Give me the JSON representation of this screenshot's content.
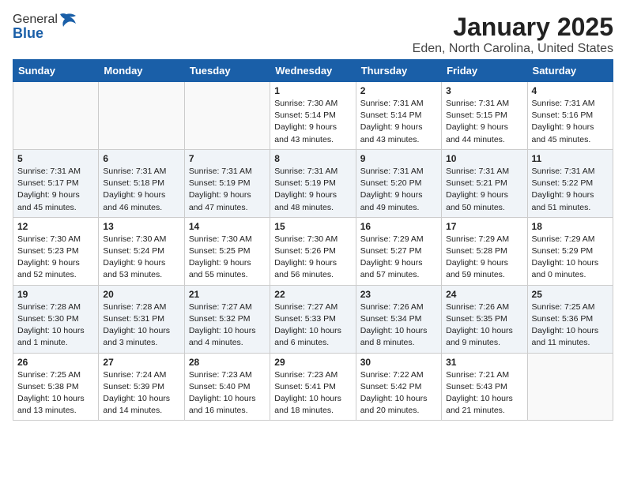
{
  "logo": {
    "general": "General",
    "blue": "Blue"
  },
  "title": "January 2025",
  "subtitle": "Eden, North Carolina, United States",
  "weekdays": [
    "Sunday",
    "Monday",
    "Tuesday",
    "Wednesday",
    "Thursday",
    "Friday",
    "Saturday"
  ],
  "weeks": [
    [
      {
        "day": "",
        "info": ""
      },
      {
        "day": "",
        "info": ""
      },
      {
        "day": "",
        "info": ""
      },
      {
        "day": "1",
        "info": "Sunrise: 7:30 AM\nSunset: 5:14 PM\nDaylight: 9 hours\nand 43 minutes."
      },
      {
        "day": "2",
        "info": "Sunrise: 7:31 AM\nSunset: 5:14 PM\nDaylight: 9 hours\nand 43 minutes."
      },
      {
        "day": "3",
        "info": "Sunrise: 7:31 AM\nSunset: 5:15 PM\nDaylight: 9 hours\nand 44 minutes."
      },
      {
        "day": "4",
        "info": "Sunrise: 7:31 AM\nSunset: 5:16 PM\nDaylight: 9 hours\nand 45 minutes."
      }
    ],
    [
      {
        "day": "5",
        "info": "Sunrise: 7:31 AM\nSunset: 5:17 PM\nDaylight: 9 hours\nand 45 minutes."
      },
      {
        "day": "6",
        "info": "Sunrise: 7:31 AM\nSunset: 5:18 PM\nDaylight: 9 hours\nand 46 minutes."
      },
      {
        "day": "7",
        "info": "Sunrise: 7:31 AM\nSunset: 5:19 PM\nDaylight: 9 hours\nand 47 minutes."
      },
      {
        "day": "8",
        "info": "Sunrise: 7:31 AM\nSunset: 5:19 PM\nDaylight: 9 hours\nand 48 minutes."
      },
      {
        "day": "9",
        "info": "Sunrise: 7:31 AM\nSunset: 5:20 PM\nDaylight: 9 hours\nand 49 minutes."
      },
      {
        "day": "10",
        "info": "Sunrise: 7:31 AM\nSunset: 5:21 PM\nDaylight: 9 hours\nand 50 minutes."
      },
      {
        "day": "11",
        "info": "Sunrise: 7:31 AM\nSunset: 5:22 PM\nDaylight: 9 hours\nand 51 minutes."
      }
    ],
    [
      {
        "day": "12",
        "info": "Sunrise: 7:30 AM\nSunset: 5:23 PM\nDaylight: 9 hours\nand 52 minutes."
      },
      {
        "day": "13",
        "info": "Sunrise: 7:30 AM\nSunset: 5:24 PM\nDaylight: 9 hours\nand 53 minutes."
      },
      {
        "day": "14",
        "info": "Sunrise: 7:30 AM\nSunset: 5:25 PM\nDaylight: 9 hours\nand 55 minutes."
      },
      {
        "day": "15",
        "info": "Sunrise: 7:30 AM\nSunset: 5:26 PM\nDaylight: 9 hours\nand 56 minutes."
      },
      {
        "day": "16",
        "info": "Sunrise: 7:29 AM\nSunset: 5:27 PM\nDaylight: 9 hours\nand 57 minutes."
      },
      {
        "day": "17",
        "info": "Sunrise: 7:29 AM\nSunset: 5:28 PM\nDaylight: 9 hours\nand 59 minutes."
      },
      {
        "day": "18",
        "info": "Sunrise: 7:29 AM\nSunset: 5:29 PM\nDaylight: 10 hours\nand 0 minutes."
      }
    ],
    [
      {
        "day": "19",
        "info": "Sunrise: 7:28 AM\nSunset: 5:30 PM\nDaylight: 10 hours\nand 1 minute."
      },
      {
        "day": "20",
        "info": "Sunrise: 7:28 AM\nSunset: 5:31 PM\nDaylight: 10 hours\nand 3 minutes."
      },
      {
        "day": "21",
        "info": "Sunrise: 7:27 AM\nSunset: 5:32 PM\nDaylight: 10 hours\nand 4 minutes."
      },
      {
        "day": "22",
        "info": "Sunrise: 7:27 AM\nSunset: 5:33 PM\nDaylight: 10 hours\nand 6 minutes."
      },
      {
        "day": "23",
        "info": "Sunrise: 7:26 AM\nSunset: 5:34 PM\nDaylight: 10 hours\nand 8 minutes."
      },
      {
        "day": "24",
        "info": "Sunrise: 7:26 AM\nSunset: 5:35 PM\nDaylight: 10 hours\nand 9 minutes."
      },
      {
        "day": "25",
        "info": "Sunrise: 7:25 AM\nSunset: 5:36 PM\nDaylight: 10 hours\nand 11 minutes."
      }
    ],
    [
      {
        "day": "26",
        "info": "Sunrise: 7:25 AM\nSunset: 5:38 PM\nDaylight: 10 hours\nand 13 minutes."
      },
      {
        "day": "27",
        "info": "Sunrise: 7:24 AM\nSunset: 5:39 PM\nDaylight: 10 hours\nand 14 minutes."
      },
      {
        "day": "28",
        "info": "Sunrise: 7:23 AM\nSunset: 5:40 PM\nDaylight: 10 hours\nand 16 minutes."
      },
      {
        "day": "29",
        "info": "Sunrise: 7:23 AM\nSunset: 5:41 PM\nDaylight: 10 hours\nand 18 minutes."
      },
      {
        "day": "30",
        "info": "Sunrise: 7:22 AM\nSunset: 5:42 PM\nDaylight: 10 hours\nand 20 minutes."
      },
      {
        "day": "31",
        "info": "Sunrise: 7:21 AM\nSunset: 5:43 PM\nDaylight: 10 hours\nand 21 minutes."
      },
      {
        "day": "",
        "info": ""
      }
    ]
  ]
}
